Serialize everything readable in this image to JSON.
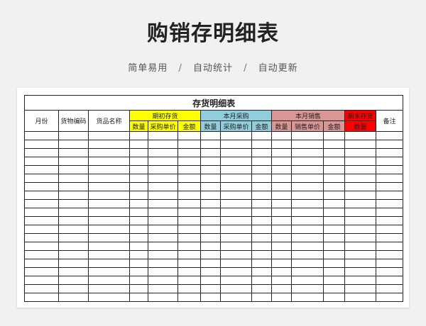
{
  "page": {
    "title": "购销存明细表",
    "tagline": [
      "简单易用",
      "自动统计",
      "自动更新"
    ],
    "separator": "/"
  },
  "sheet": {
    "caption": "存货明细表",
    "headers": {
      "month": "月份",
      "code": "货物编码",
      "name": "货品名称",
      "opening": "期初存货",
      "purchase": "本月采购",
      "sales": "本月销售",
      "closing": "期末存货",
      "remark": "备注",
      "qty": "数量",
      "buy_price": "采购单价",
      "sell_price": "销售单价",
      "amount": "金额"
    },
    "colors": {
      "opening": "#ffff00",
      "purchase": "#92cddc",
      "sales": "#da9694",
      "closing": "#ff0000"
    },
    "empty_rows": 20
  }
}
